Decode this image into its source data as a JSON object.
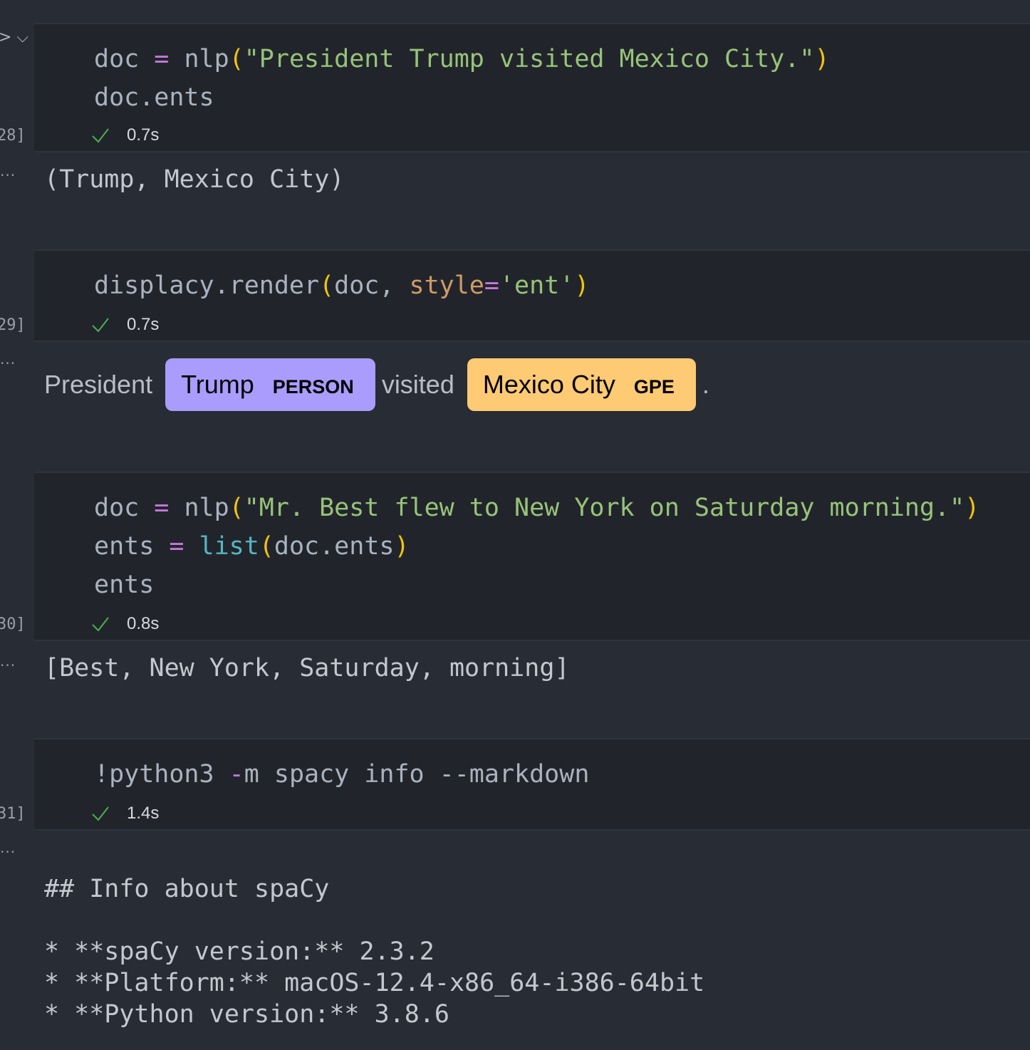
{
  "cells": [
    {
      "exec": "28]",
      "time": "0.7s",
      "output": "(Trump, Mexico City)"
    },
    {
      "exec": "29]",
      "time": "0.7s",
      "displacy": {
        "text_before": "President",
        "ent1_text": "Trump",
        "ent1_label": "PERSON",
        "ent1_color": "#aa9cfc",
        "text_between": "visited",
        "ent2_text": "Mexico City",
        "ent2_label": "GPE",
        "ent2_color": "#feca74",
        "text_after": "."
      }
    },
    {
      "exec": "30]",
      "time": "0.8s",
      "output": "[Best, New York, Saturday, morning]"
    },
    {
      "exec": "31]",
      "time": "1.4s",
      "output_lines": [
        "## Info about spaCy",
        "* **spaCy version:** 2.3.2",
        "* **Platform:** macOS-12.4-x86_64-i386-64bit",
        "* **Python version:** 3.8.6"
      ]
    }
  ],
  "code": {
    "c1_l1": [
      "doc",
      " = ",
      "nlp",
      "(",
      "\"President Trump visited Mexico City.\"",
      ")"
    ],
    "c1_l2": "doc.ents",
    "c2_l1": [
      "displacy.render",
      "(",
      "doc, ",
      "style",
      "=",
      "'ent'",
      ")"
    ],
    "c3_l1": [
      "doc",
      " = ",
      "nlp",
      "(",
      "\"Mr. Best flew to New York on Saturday morning.\"",
      ")"
    ],
    "c3_l2": [
      "ents",
      " = ",
      "list",
      "(",
      "doc.ents",
      ")"
    ],
    "c3_l3": "ents",
    "c4_l1": [
      "!python3 ",
      "-",
      "m spacy info --markdown"
    ]
  },
  "ui": {
    "collapse_glyph": "> ⌵",
    "more_glyph": "···",
    "check_icon": "check-icon",
    "success_color": "#4caf50"
  }
}
